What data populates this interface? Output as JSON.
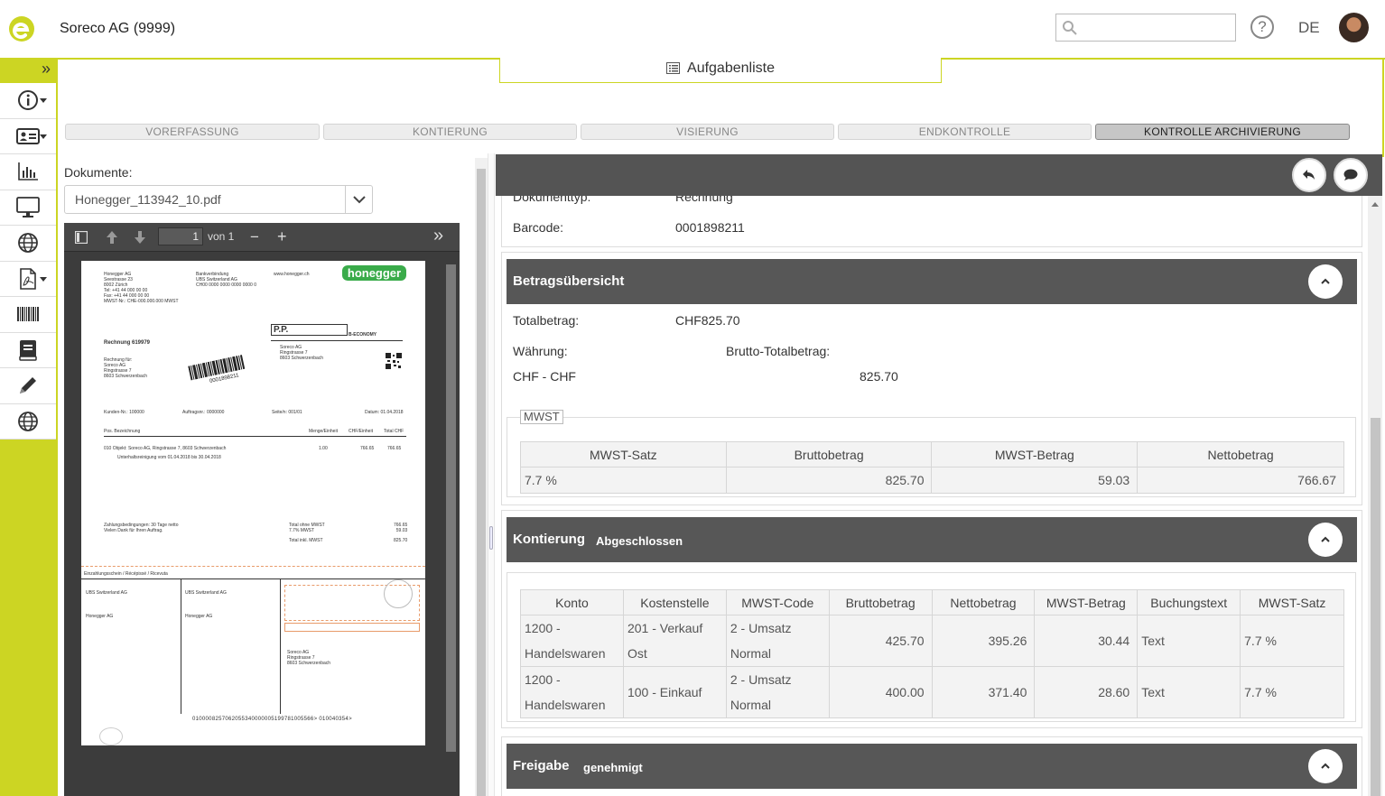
{
  "header": {
    "company": "Soreco AG (9999)",
    "search_placeholder": "",
    "help": "?",
    "language": "DE"
  },
  "sidebar": {
    "toggle": "»",
    "items": [
      {
        "icon": "info-icon",
        "has_caret": true
      },
      {
        "icon": "contact-card-icon",
        "has_caret": true
      },
      {
        "icon": "bar-chart-icon",
        "has_caret": false
      },
      {
        "icon": "monitor-icon",
        "has_caret": false
      },
      {
        "icon": "globe-icon",
        "has_caret": false
      },
      {
        "icon": "pdf-file-icon",
        "has_caret": true
      },
      {
        "icon": "barcode-icon",
        "has_caret": false
      },
      {
        "icon": "book-icon",
        "has_caret": false
      },
      {
        "icon": "pencil-icon",
        "has_caret": false
      },
      {
        "icon": "globe-icon",
        "has_caret": false
      }
    ]
  },
  "tasklist": {
    "label": "Aufgabenliste"
  },
  "steps": [
    {
      "label": "VORERFASSUNG",
      "active": false
    },
    {
      "label": "KONTIERUNG",
      "active": false
    },
    {
      "label": "VISIERUNG",
      "active": false
    },
    {
      "label": "ENDKONTROLLE",
      "active": false
    },
    {
      "label": "KONTROLLE ARCHIVIERUNG",
      "active": true
    }
  ],
  "documents": {
    "label": "Dokumente:",
    "selected": "Honegger_113942_10.pdf"
  },
  "viewer": {
    "page": "1",
    "page_of": "von 1",
    "zoom_out": "−",
    "zoom_in": "+",
    "more": "»"
  },
  "invoice": {
    "logo_text": "honegger",
    "sender": [
      "Honegger AG",
      "Seestrasse 23",
      "8002 Zürich",
      "Tel: +41 44 000 00 00",
      "Fax: +41 44 000 00 00",
      "MWST-Nr.: CHE-000.000.000 MWST"
    ],
    "bank": [
      "Bankverbindung",
      "UBS Switzerland AG",
      "CH00 0000 0000 0000 0000 0"
    ],
    "web": "www.honegger.ch",
    "pp": "P.P.",
    "economy": "B-ECONOMY",
    "recipient": [
      "Soreco AG",
      "Ringstrasse 7",
      "8603 Schwerzenbach"
    ],
    "title": "Rechnung 619979",
    "barcode_number": "0001898211",
    "bill_to": [
      "Rechnung für:",
      "Soreco AG",
      "Ringstrasse 7",
      "8603 Schwerzenbach"
    ],
    "meta": [
      "Kunden-Nr.: 100000",
      "Auftragsnr.: 0000000",
      "Seite/n: 001/01",
      "Datum: 01.04.2018"
    ],
    "cols": [
      "Pos. Bezeichnung",
      "Menge/Einheit",
      "CHF/Einheit",
      "Total CHF"
    ],
    "line": "010 Objekt: Soreco AG, Ringstrasse 7, 8603 Schwerzenbach",
    "line_detail": "Unterhaltsreinigung vom 01.04.2018 bis 30.04.2018",
    "line_qty": "1.00",
    "line_price": "766.65",
    "line_total": "766.65",
    "terms": [
      "Zahlungsbedingungen: 30 Tage netto",
      "Vielen Dank für Ihren Auftrag."
    ],
    "totals": [
      "Total ohne MWST",
      "7.7% MWST",
      "Total inkl. MWST"
    ],
    "totals_vals": [
      "766.65",
      "59.03",
      "825.70"
    ],
    "slip_header": "Einzahlungsschein / Récépissé / Ricevuta",
    "slip_bank": "UBS Switzerland AG",
    "codeline": "0100008257062055340000005199781005566>  010040354>"
  },
  "panel": {
    "partial_label": "Dokumenttyp:",
    "partial_value": "Rechnung",
    "barcode_label": "Barcode:",
    "barcode_value": "0001898211"
  },
  "betrag": {
    "title": "Betragsübersicht",
    "total_label": "Totalbetrag:",
    "total_value": "CHF825.70",
    "currency_label": "Währung:",
    "currency_value": "CHF - CHF",
    "gross_label": "Brutto-Totalbetrag:",
    "gross_value": "825.70",
    "mwst_legend": "MWST",
    "mwst_headers": [
      "MWST-Satz",
      "Bruttobetrag",
      "MWST-Betrag",
      "Nettobetrag"
    ],
    "mwst_rows": [
      [
        "7.7 %",
        "825.70",
        "59.03",
        "766.67"
      ]
    ]
  },
  "kontierung": {
    "title": "Kontierung",
    "status": "Abgeschlossen",
    "headers": [
      "Konto",
      "Kostenstelle",
      "MWST-Code",
      "Bruttobetrag",
      "Nettobetrag",
      "MWST-Betrag",
      "Buchungstext",
      "MWST-Satz"
    ],
    "rows": [
      {
        "konto": [
          "1200 -",
          "Handelswaren"
        ],
        "kostenstelle": [
          "201 - Verkauf",
          "Ost"
        ],
        "mwst_code": [
          "2 - Umsatz",
          "Normal"
        ],
        "brutto": "425.70",
        "netto": "395.26",
        "mwst": "30.44",
        "text": "Text",
        "satz": "7.7 %"
      },
      {
        "konto": [
          "1200 -",
          "Handelswaren"
        ],
        "kostenstelle": [
          "100 - Einkauf"
        ],
        "mwst_code": [
          "2 - Umsatz",
          "Normal"
        ],
        "brutto": "400.00",
        "netto": "371.40",
        "mwst": "28.60",
        "text": "Text",
        "satz": "7.7 %"
      }
    ]
  },
  "freigabe": {
    "title": "Freigabe",
    "status": "genehmigt"
  },
  "colors": {
    "accent": "#ccd523",
    "panel_header": "#575757"
  }
}
